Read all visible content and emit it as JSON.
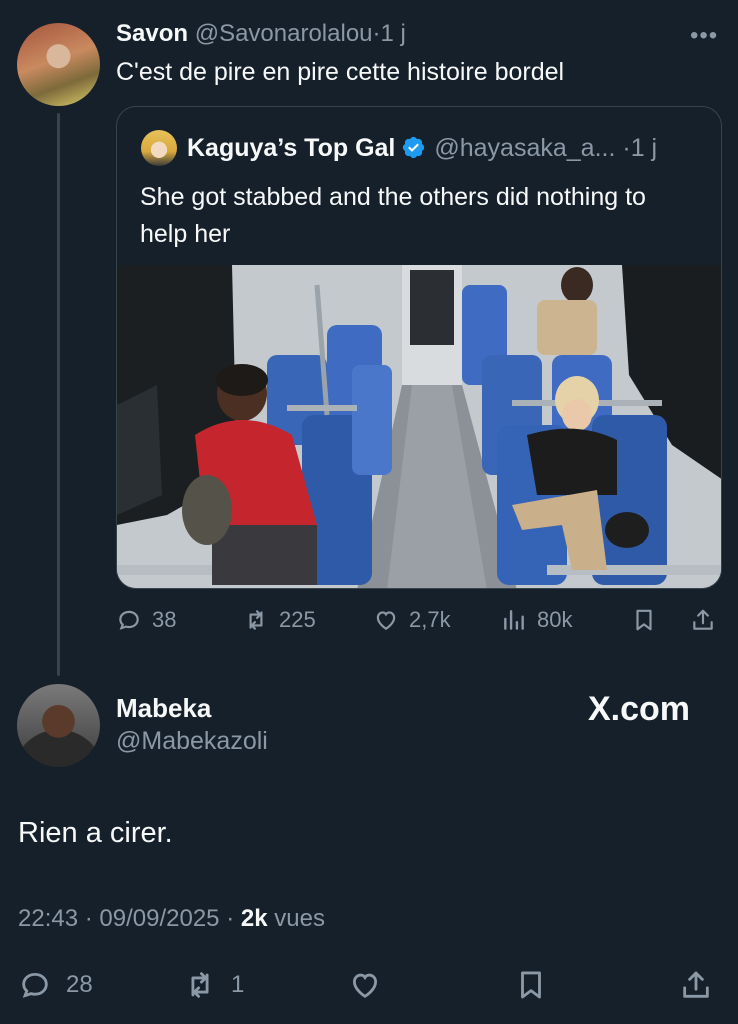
{
  "parent": {
    "name": "Savon",
    "handle": "@Savonarolalou",
    "time": "1 j",
    "text": "C'est de pire en pire cette histoire bordel",
    "more": "•••"
  },
  "quote": {
    "name": "Kaguya’s Top Gal",
    "handle": "@hayasaka_a...",
    "time": "1 j",
    "text": "She got stabbed and the others did nothing to help her"
  },
  "parent_actions": {
    "replies": "38",
    "reposts": "225",
    "likes": "2,7k",
    "views": "80k"
  },
  "main": {
    "name": "Mabeka",
    "handle": "@Mabekazoli",
    "watermark": "X.com",
    "text": "Rien a cirer.",
    "time": "22:43",
    "date": "09/09/2025",
    "views_count": "2k",
    "views_label": "vues"
  },
  "main_actions": {
    "replies": "28",
    "reposts": "1"
  },
  "colors": {
    "background": "#15202b",
    "text": "#f7f9f9",
    "muted": "#8b98a5",
    "border": "#38444d",
    "verified": "#1d9bf0"
  }
}
